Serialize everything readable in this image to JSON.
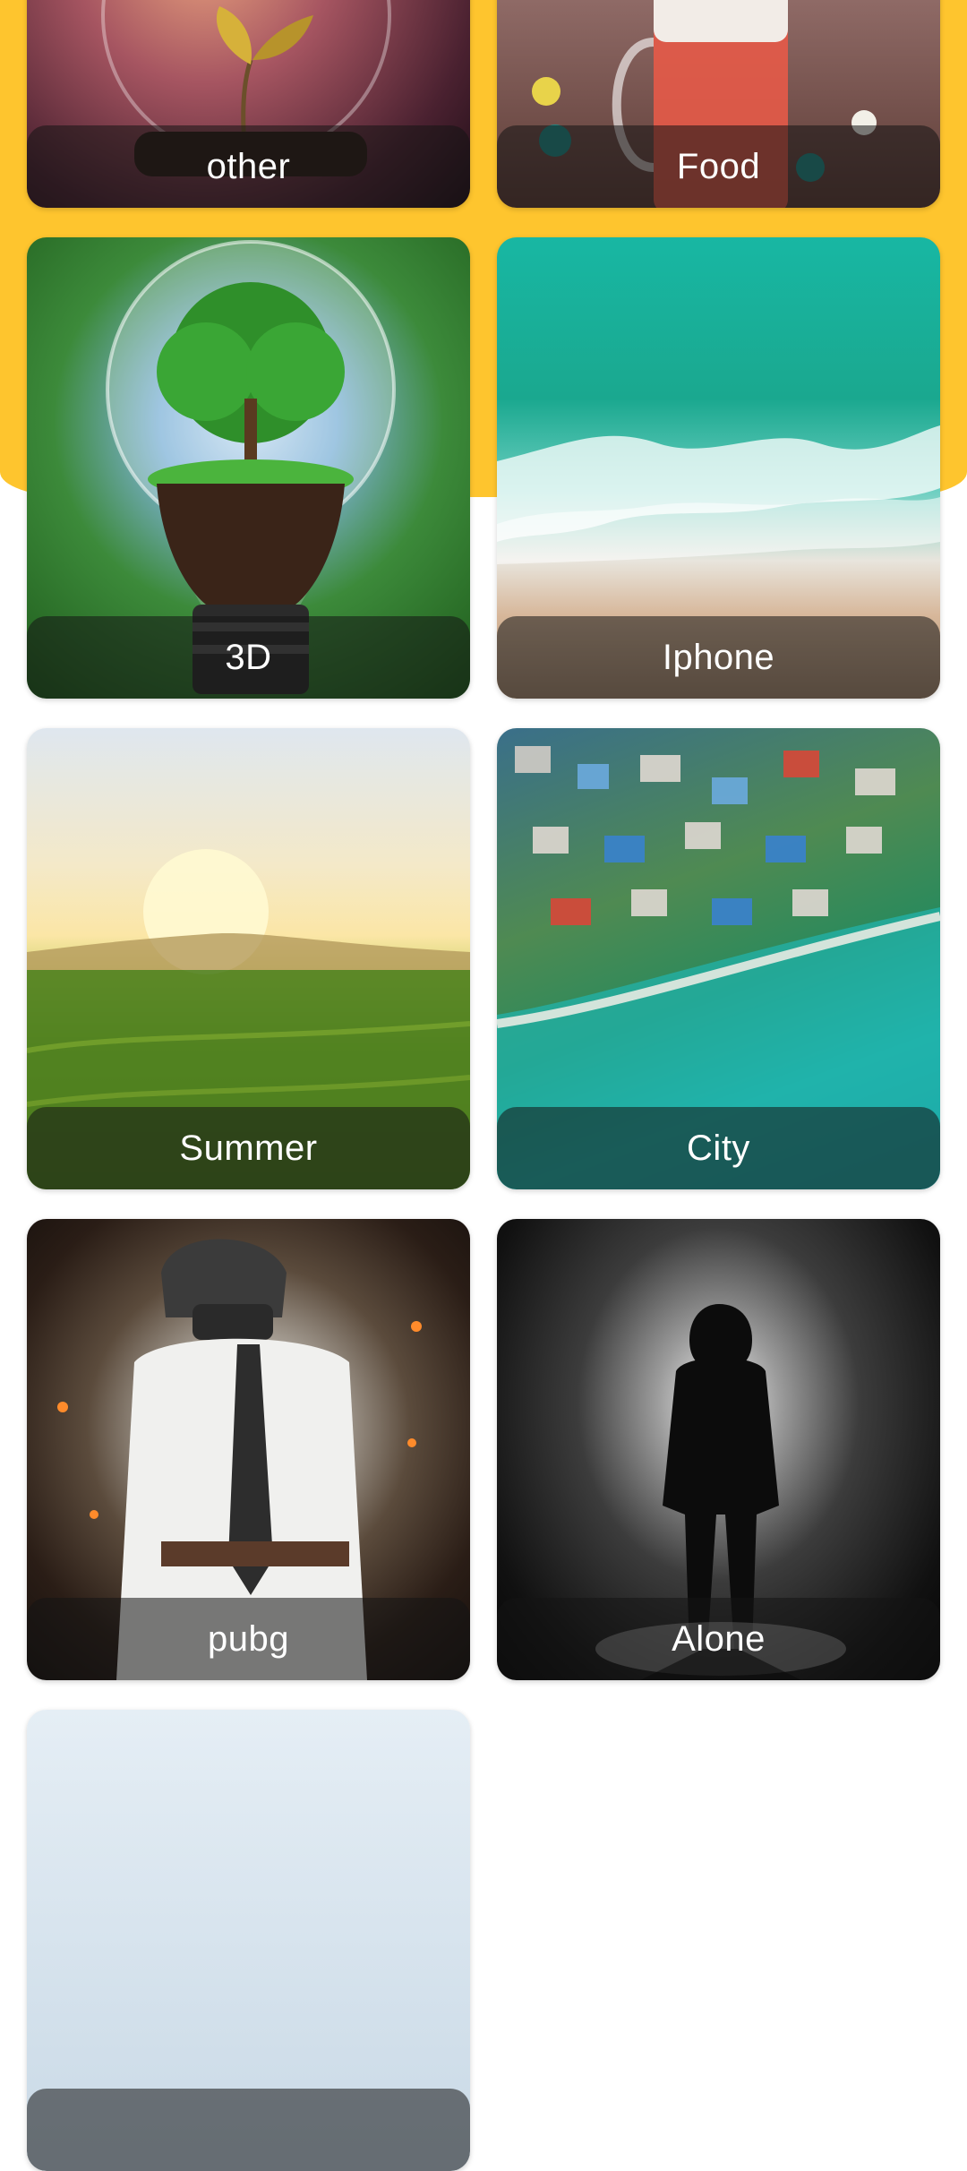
{
  "theme": {
    "accent": "#FEC52E",
    "overlay": "rgba(20,20,20,0.55)"
  },
  "categories": [
    {
      "label": "other"
    },
    {
      "label": "Food"
    },
    {
      "label": "3D"
    },
    {
      "label": "Iphone"
    },
    {
      "label": "Summer"
    },
    {
      "label": "City"
    },
    {
      "label": "pubg"
    },
    {
      "label": "Alone"
    },
    {
      "label": ""
    }
  ]
}
